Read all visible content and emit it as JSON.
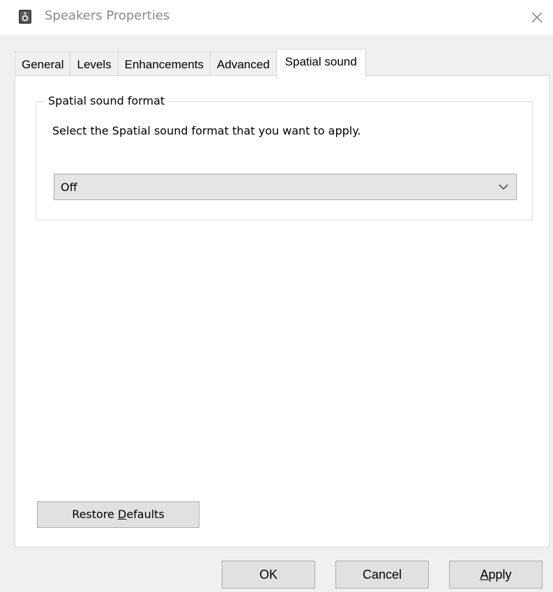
{
  "window": {
    "title": "Speakers Properties",
    "title_icon": "speaker-icon",
    "close_icon": "close-icon"
  },
  "tabs": [
    {
      "label": "General",
      "active": false
    },
    {
      "label": "Levels",
      "active": false
    },
    {
      "label": "Enhancements",
      "active": false
    },
    {
      "label": "Advanced",
      "active": false
    },
    {
      "label": "Spatial sound",
      "active": true
    }
  ],
  "spatial_group": {
    "legend": "Spatial sound format",
    "description": "Select the Spatial sound format that you want to apply.",
    "format_select": {
      "selected": "Off",
      "icon": "chevron-down-icon"
    }
  },
  "restore_button": {
    "prefix": "Restore ",
    "access_key": "D",
    "suffix": "efaults"
  },
  "footer": {
    "ok_label": "OK",
    "cancel_label": "Cancel",
    "apply_access_key": "A",
    "apply_suffix": "pply"
  },
  "colors": {
    "window_bg": "#f0f0f0",
    "panel_bg": "#ffffff",
    "button_bg": "#e1e1e1",
    "button_border": "#adadad",
    "title_text": "#8a8a8a"
  }
}
